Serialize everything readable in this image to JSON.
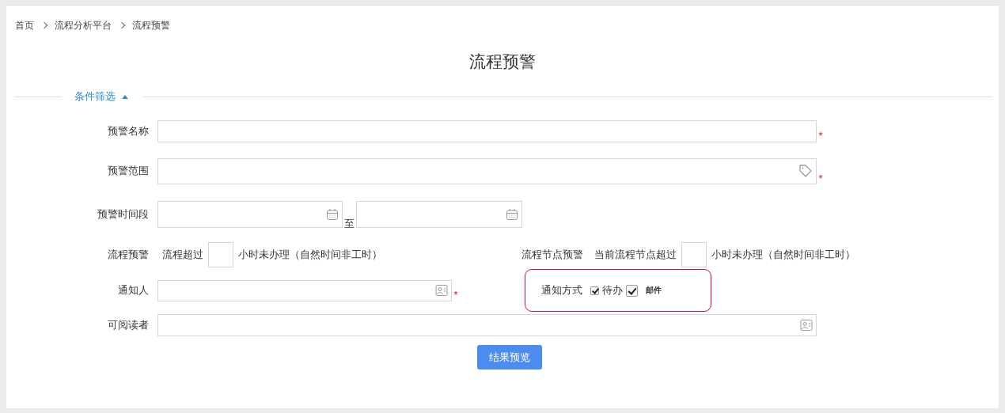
{
  "breadcrumb": [
    "首页",
    "流程分析平台",
    "流程预警"
  ],
  "title": "流程预警",
  "section": {
    "label": "条件筛选",
    "expanded": true
  },
  "fields": [
    {
      "kind": "text",
      "label": "预警名称",
      "required": true
    },
    {
      "kind": "tag",
      "label": "预警范围",
      "required": true
    },
    {
      "kind": "daterange",
      "label": "预警时间段",
      "separator": "至"
    }
  ],
  "thresholds": [
    {
      "label": "流程预警",
      "prefix": "流程超过",
      "suffix": "小时未办理（自然时间非工时）"
    },
    {
      "label": "流程节点预警",
      "prefix": "当前流程节点超过",
      "suffix": "小时未办理（自然时间非工时）"
    }
  ],
  "notify_person": {
    "label": "通知人",
    "required": true
  },
  "notify_method": {
    "label": "通知方式",
    "highlighted": true,
    "options": [
      {
        "label": "待办",
        "checked": true
      },
      {
        "label": "邮件",
        "checked": true
      }
    ]
  },
  "readers": {
    "label": "可阅读者"
  },
  "button": "结果预览"
}
